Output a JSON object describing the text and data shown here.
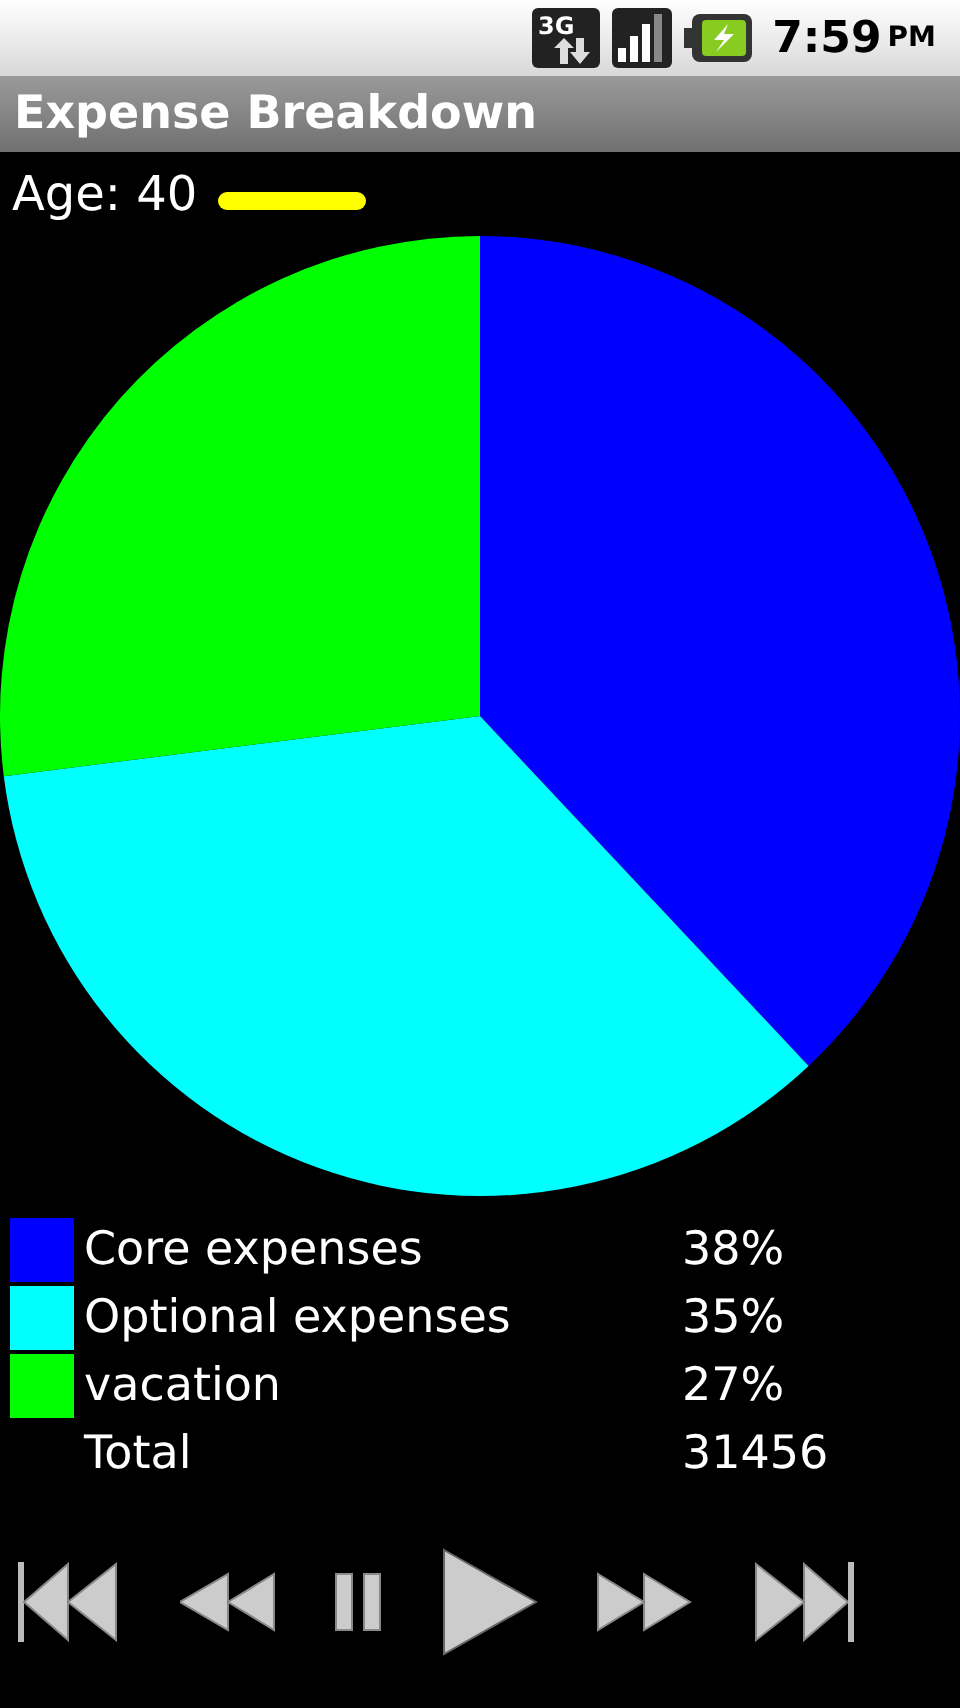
{
  "status_bar": {
    "time": "7:59",
    "ampm": "PM",
    "network": "3G"
  },
  "title": "Expense Breakdown",
  "age": {
    "label": "Age: 40"
  },
  "chart": {
    "chart_data": {
      "type": "pie",
      "categories": [
        "Core expenses",
        "Optional expenses",
        "vacation"
      ],
      "values": [
        38,
        35,
        27
      ]
    }
  },
  "legend": [
    {
      "value": "38%",
      "color": "#0000ff"
    },
    {
      "value": "35%",
      "color": "#00ffff"
    },
    {
      "value": "27%",
      "color": "#00ff00"
    }
  ],
  "total": {
    "label": "Total",
    "value": "31456"
  }
}
